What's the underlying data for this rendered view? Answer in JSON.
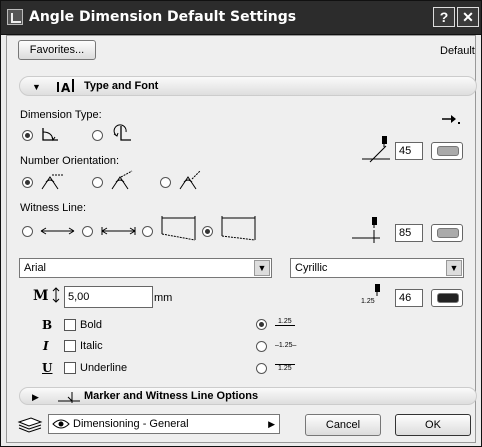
{
  "window": {
    "title": "Angle Dimension Default Settings",
    "help_label": "?",
    "close_label": "✕"
  },
  "header": {
    "favorites_label": "Favorites...",
    "default_label": "Default"
  },
  "type_font": {
    "section_title": "Type and Font",
    "dimension_type_label": "Dimension Type:",
    "dimension_type_options": [
      "arc-within",
      "arc-around"
    ],
    "dimension_type_selected": 0,
    "pen1_value": "45",
    "number_orientation_label": "Number Orientation:",
    "number_orientation_selected": 0,
    "witness_line_label": "Witness Line:",
    "witness_line_selected": 3,
    "pen2_value": "85",
    "font_value": "Arial",
    "script_value": "Cyrillic",
    "size_value": "5,00",
    "size_unit": "mm",
    "text_pen_label": "1.25",
    "pen3_value": "46",
    "bold_label": "Bold",
    "italic_label": "Italic",
    "underline_label": "Underline",
    "bold_glyph": "B",
    "italic_glyph": "I",
    "underline_glyph": "U",
    "number_format_options": [
      "1.25",
      "–1.25–",
      "1.25"
    ],
    "number_format_selected": 0
  },
  "marker_section": {
    "section_title": "Marker and Witness Line Options"
  },
  "footer": {
    "layer_value": "Dimensioning - General",
    "cancel_label": "Cancel",
    "ok_label": "OK"
  },
  "colors": {
    "titlebar": "#2c2c2c",
    "panel": "#efefef",
    "pen_swatch_light": "#aaaaaa",
    "pen_swatch_dark": "#222222"
  }
}
